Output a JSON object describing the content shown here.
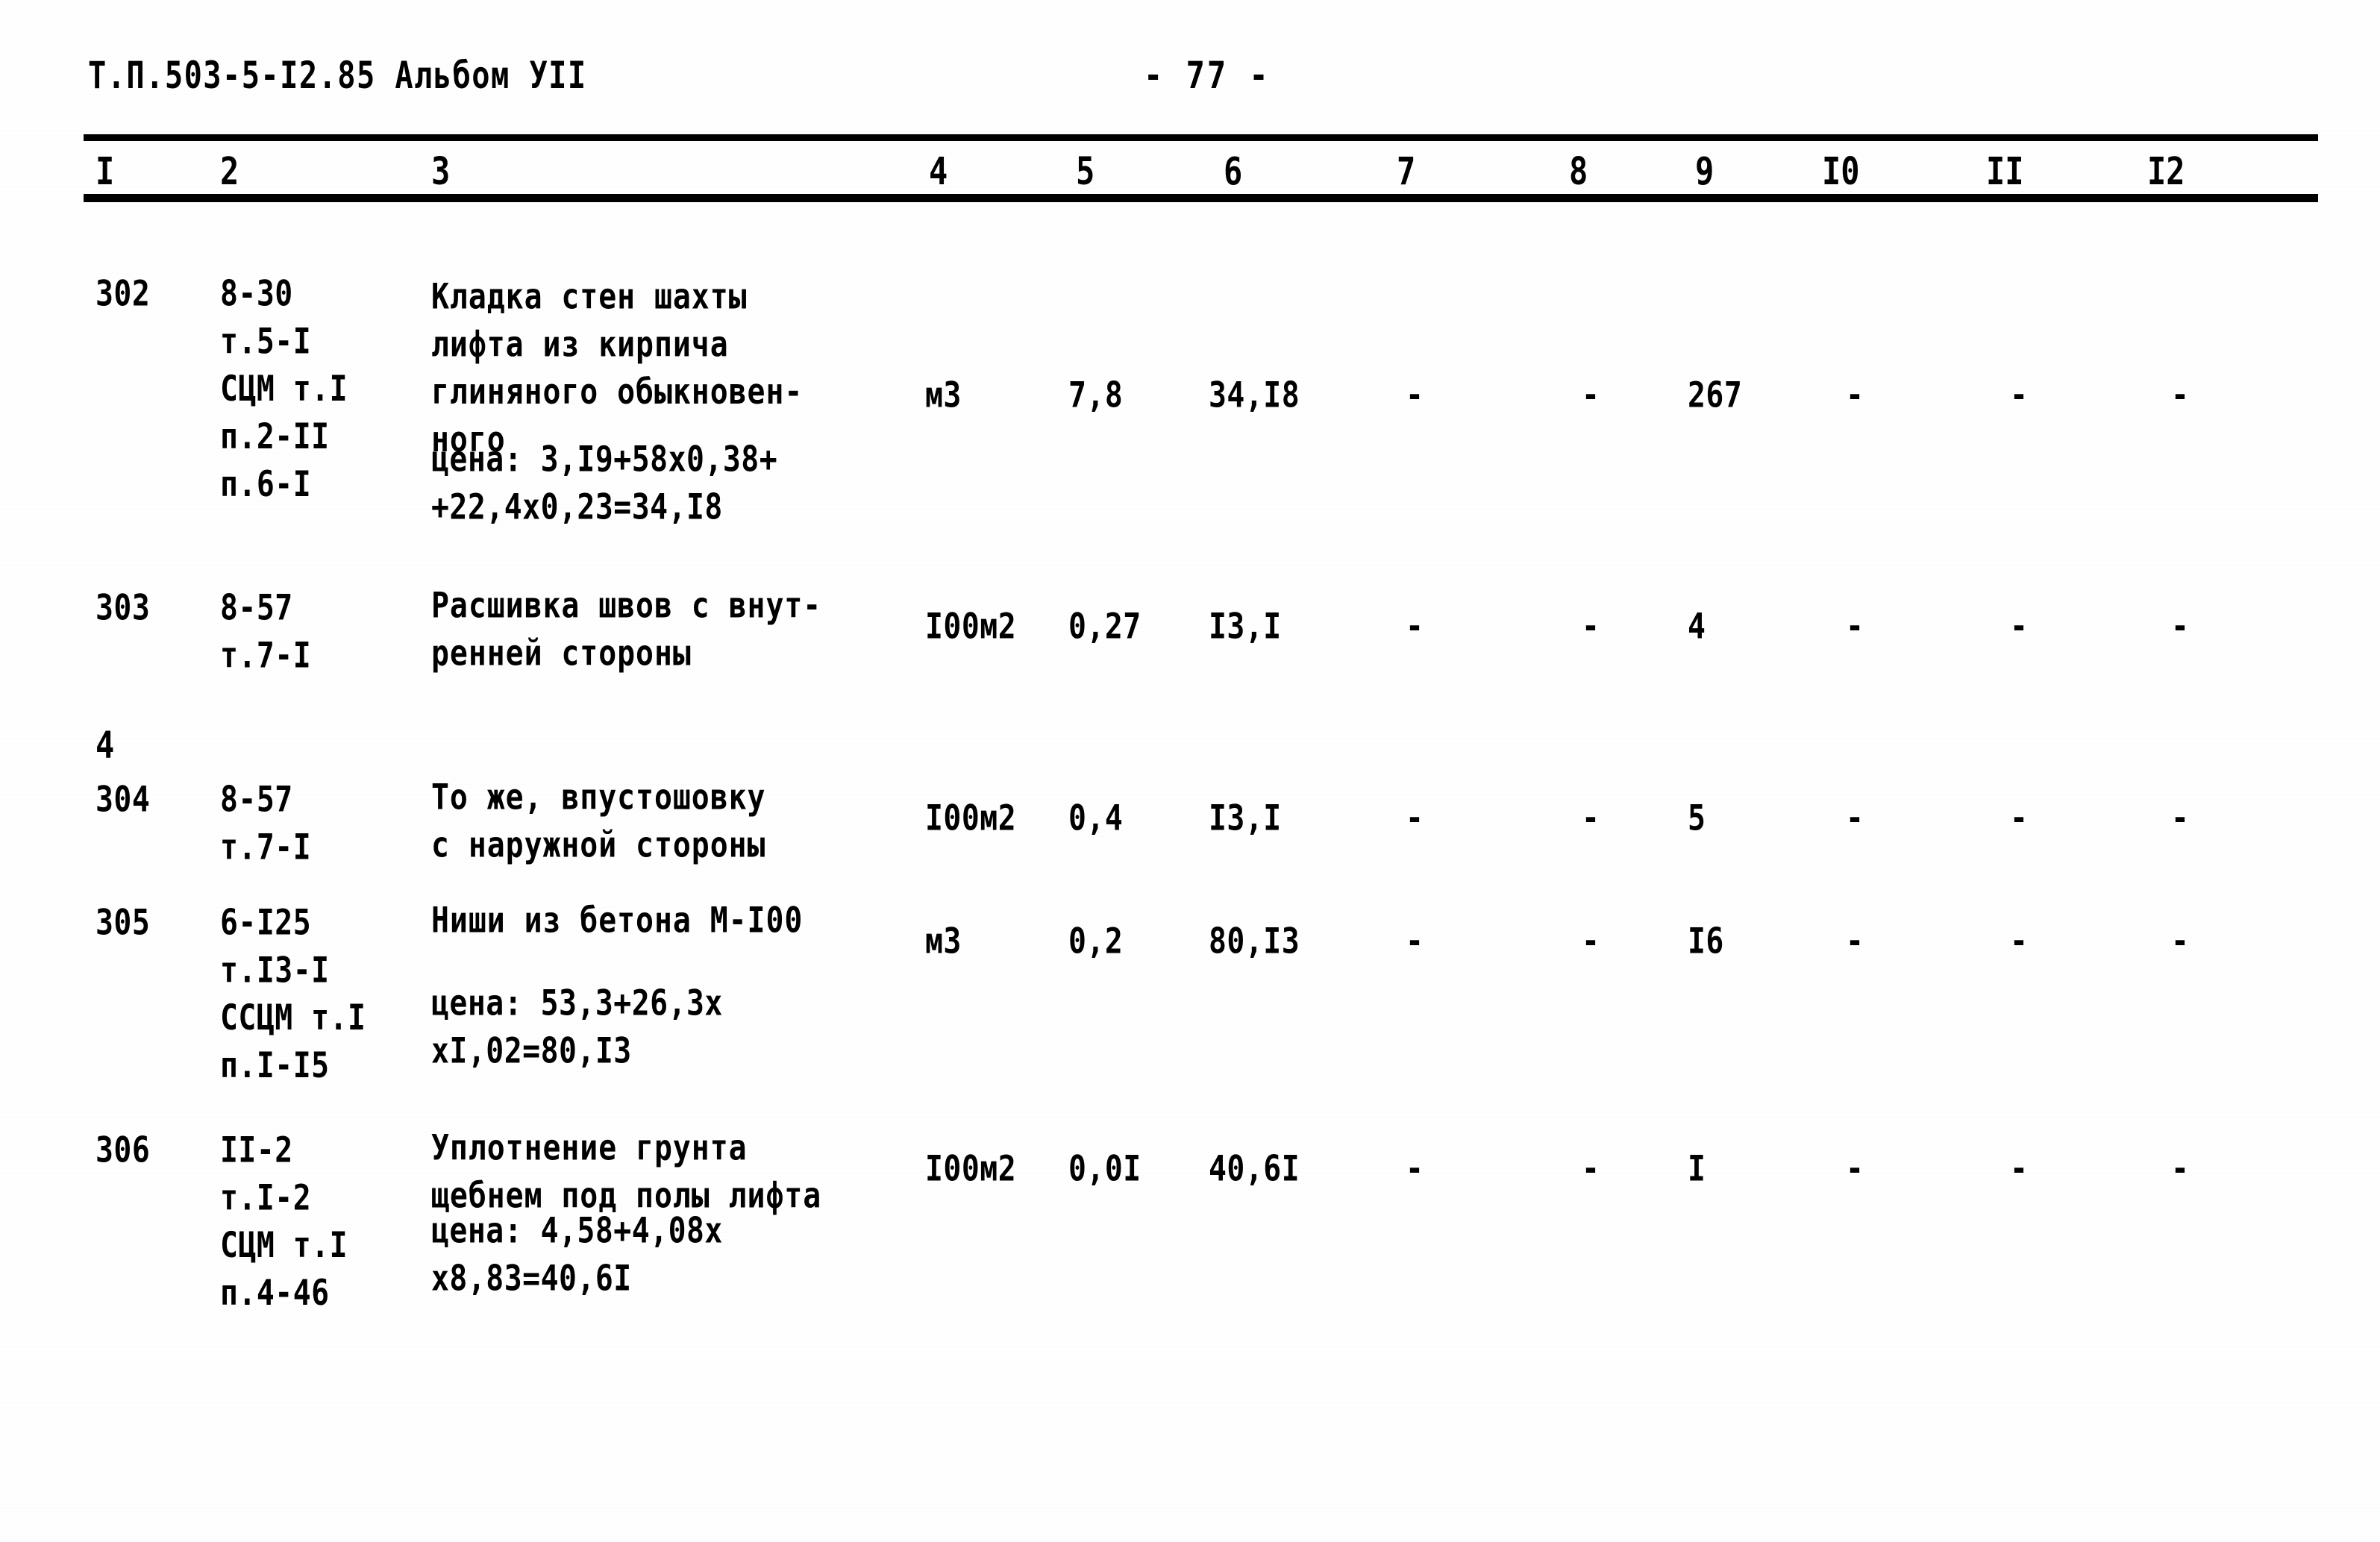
{
  "header": {
    "document_code": "Т.П.503-5-I2.85 Альбом УII",
    "page_label": "- 77 -"
  },
  "table": {
    "column_headers": [
      "I",
      "2",
      "3",
      "4",
      "5",
      "6",
      "7",
      "8",
      "9",
      "I0",
      "II",
      "I2"
    ],
    "stray_marks": [
      {
        "text": "4"
      }
    ],
    "rows": [
      {
        "num": "302",
        "codes": [
          "8-30",
          "т.5-I",
          "СЦМ т.I",
          "п.2-II",
          "п.6-I"
        ],
        "description": [
          "Кладка стен шахты",
          "лифта из кирпича",
          "глиняного обыкновен-",
          "ного"
        ],
        "price_lines": [
          "цена: 3,I9+58х0,38+",
          "+22,4х0,23=34,I8"
        ],
        "unit": "м3",
        "c5": "7,8",
        "c6": "34,I8",
        "c7": "-",
        "c8": "-",
        "c9": "267",
        "c10": "-",
        "c11": "-",
        "c12": "-"
      },
      {
        "num": "303",
        "codes": [
          "8-57",
          "т.7-I"
        ],
        "description": [
          "Расшивка швов с внут-",
          "ренней стороны"
        ],
        "price_lines": [],
        "unit": "I00м2",
        "c5": "0,27",
        "c6": "I3,I",
        "c7": "-",
        "c8": "-",
        "c9": "4",
        "c10": "-",
        "c11": "-",
        "c12": "-"
      },
      {
        "num": "304",
        "codes": [
          "8-57",
          "т.7-I"
        ],
        "description": [
          "То же, впустошовку",
          "с наружной стороны"
        ],
        "price_lines": [],
        "unit": "I00м2",
        "c5": "0,4",
        "c6": "I3,I",
        "c7": "-",
        "c8": "-",
        "c9": "5",
        "c10": "-",
        "c11": "-",
        "c12": "-"
      },
      {
        "num": "305",
        "codes": [
          "6-I25",
          "т.I3-I",
          "ССЦМ т.I",
          "п.I-I5"
        ],
        "description": [
          "Ниши из бетона М-I00"
        ],
        "price_lines": [
          "цена: 53,3+26,3х",
          "хI,02=80,I3"
        ],
        "unit": "м3",
        "c5": "0,2",
        "c6": "80,I3",
        "c7": "-",
        "c8": "-",
        "c9": "I6",
        "c10": "-",
        "c11": "-",
        "c12": "-"
      },
      {
        "num": "306",
        "codes": [
          "II-2",
          "т.I-2",
          "СЦМ т.I",
          "п.4-46"
        ],
        "description": [
          "Уплотнение грунта",
          "щебнем под полы лифта"
        ],
        "price_lines": [
          "цена: 4,58+4,08х",
          "х8,83=40,6I"
        ],
        "unit": "I00м2",
        "c5": "0,0I",
        "c6": "40,6I",
        "c7": "-",
        "c8": "-",
        "c9": "I",
        "c10": "-",
        "c11": "-",
        "c12": "-"
      }
    ]
  }
}
